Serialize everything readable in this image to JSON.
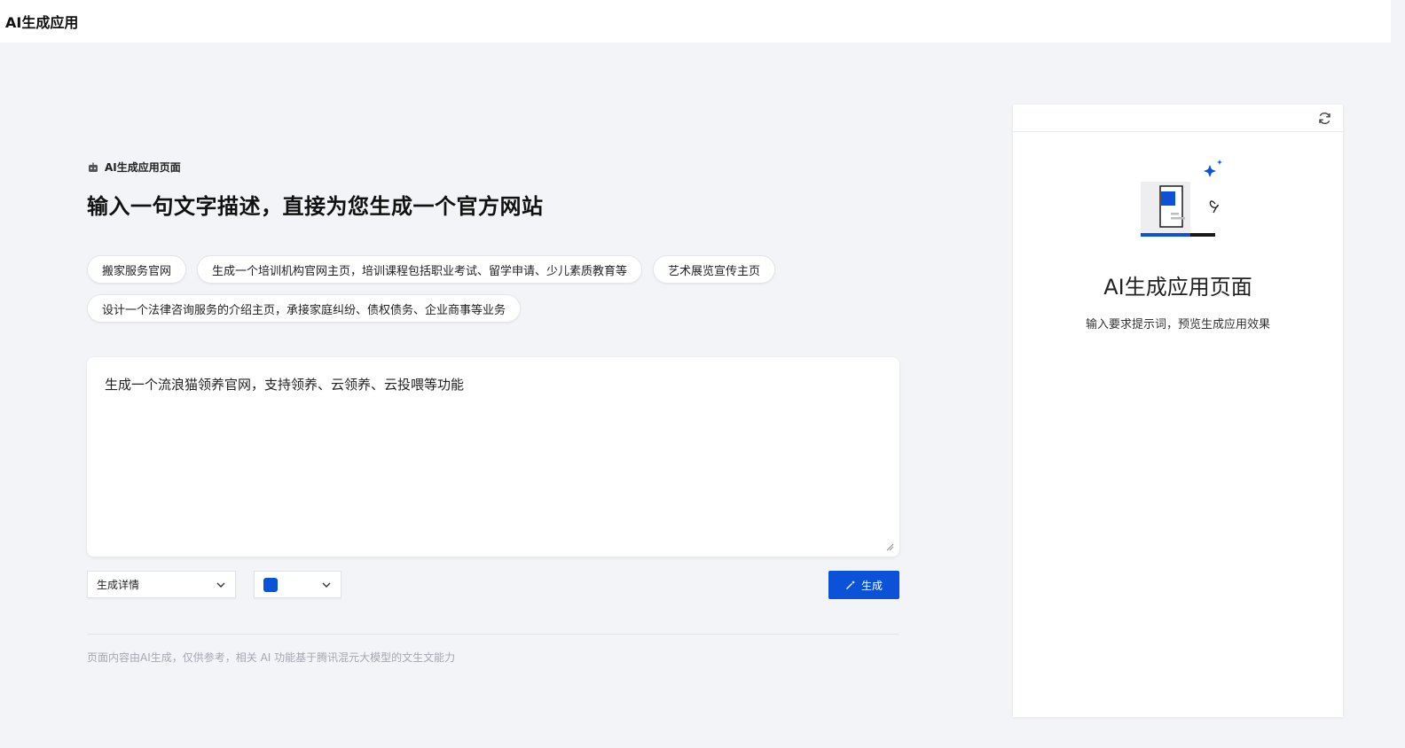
{
  "app": {
    "title": "AI生成应用"
  },
  "hero": {
    "badge": "AI生成应用页面",
    "headline": "输入一句文字描述，直接为您生成一个官方网站"
  },
  "suggestions": [
    "搬家服务官网",
    "生成一个培训机构官网主页，培训课程包括职业考试、留学申请、少儿素质教育等",
    "艺术展览宣传主页",
    "设计一个法律咨询服务的介绍主页，承接家庭纠纷、债权债务、企业商事等业务"
  ],
  "prompt": {
    "value": "生成一个流浪猫领养官网，支持领养、云领养、云投喂等功能"
  },
  "controls": {
    "type_select": "生成详情",
    "color_value": "#0b52d9",
    "generate_label": "生成"
  },
  "disclaimer": "页面内容由AI生成，仅供参考，相关 AI 功能基于腾讯混元大模型的文生文能力",
  "preview": {
    "title": "AI生成应用页面",
    "subtitle": "输入要求提示词，预览生成应用效果"
  },
  "colors": {
    "accent": "#0b52d9",
    "page_bg": "#f3f4f7"
  },
  "icons": [
    "robot-icon",
    "chevron-down-icon",
    "magic-wand-icon",
    "refresh-icon",
    "sparkle-icon"
  ]
}
